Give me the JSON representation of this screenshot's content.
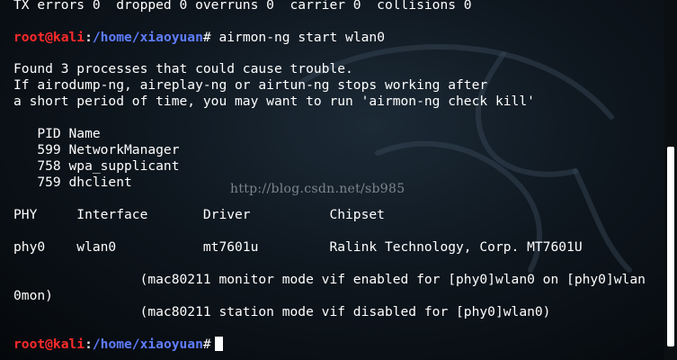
{
  "prompt": {
    "user_host": "root@kali",
    "sep": ":",
    "path": "/home/xiaoyuan",
    "mark": "#"
  },
  "output": {
    "tx_line": "TX errors 0  dropped 0 overruns 0  carrier 0  collisions 0",
    "command": " airmon-ng start wlan0",
    "found": "Found 3 processes that could cause trouble.",
    "if_line": "If airodump-ng, aireplay-ng or airtun-ng stops working after",
    "short_period": "a short period of time, you may want to run 'airmon-ng check kill'",
    "pid_header": "   PID Name",
    "processes": [
      "   599 NetworkManager",
      "   758 wpa_supplicant",
      "   759 dhclient"
    ],
    "table_header": "PHY     Interface       Driver          Chipset",
    "table_row": "phy0    wlan0           mt7601u         Ralink Technology, Corp. MT7601U",
    "monitor_line": "                (mac80211 monitor mode vif enabled for [phy0]wlan0 on [phy0]wlan",
    "monitor_wrap": "0mon)",
    "station_line": "                (mac80211 station mode vif disabled for [phy0]wlan0)"
  },
  "watermark": "http://blog.csdn.net/sb985"
}
